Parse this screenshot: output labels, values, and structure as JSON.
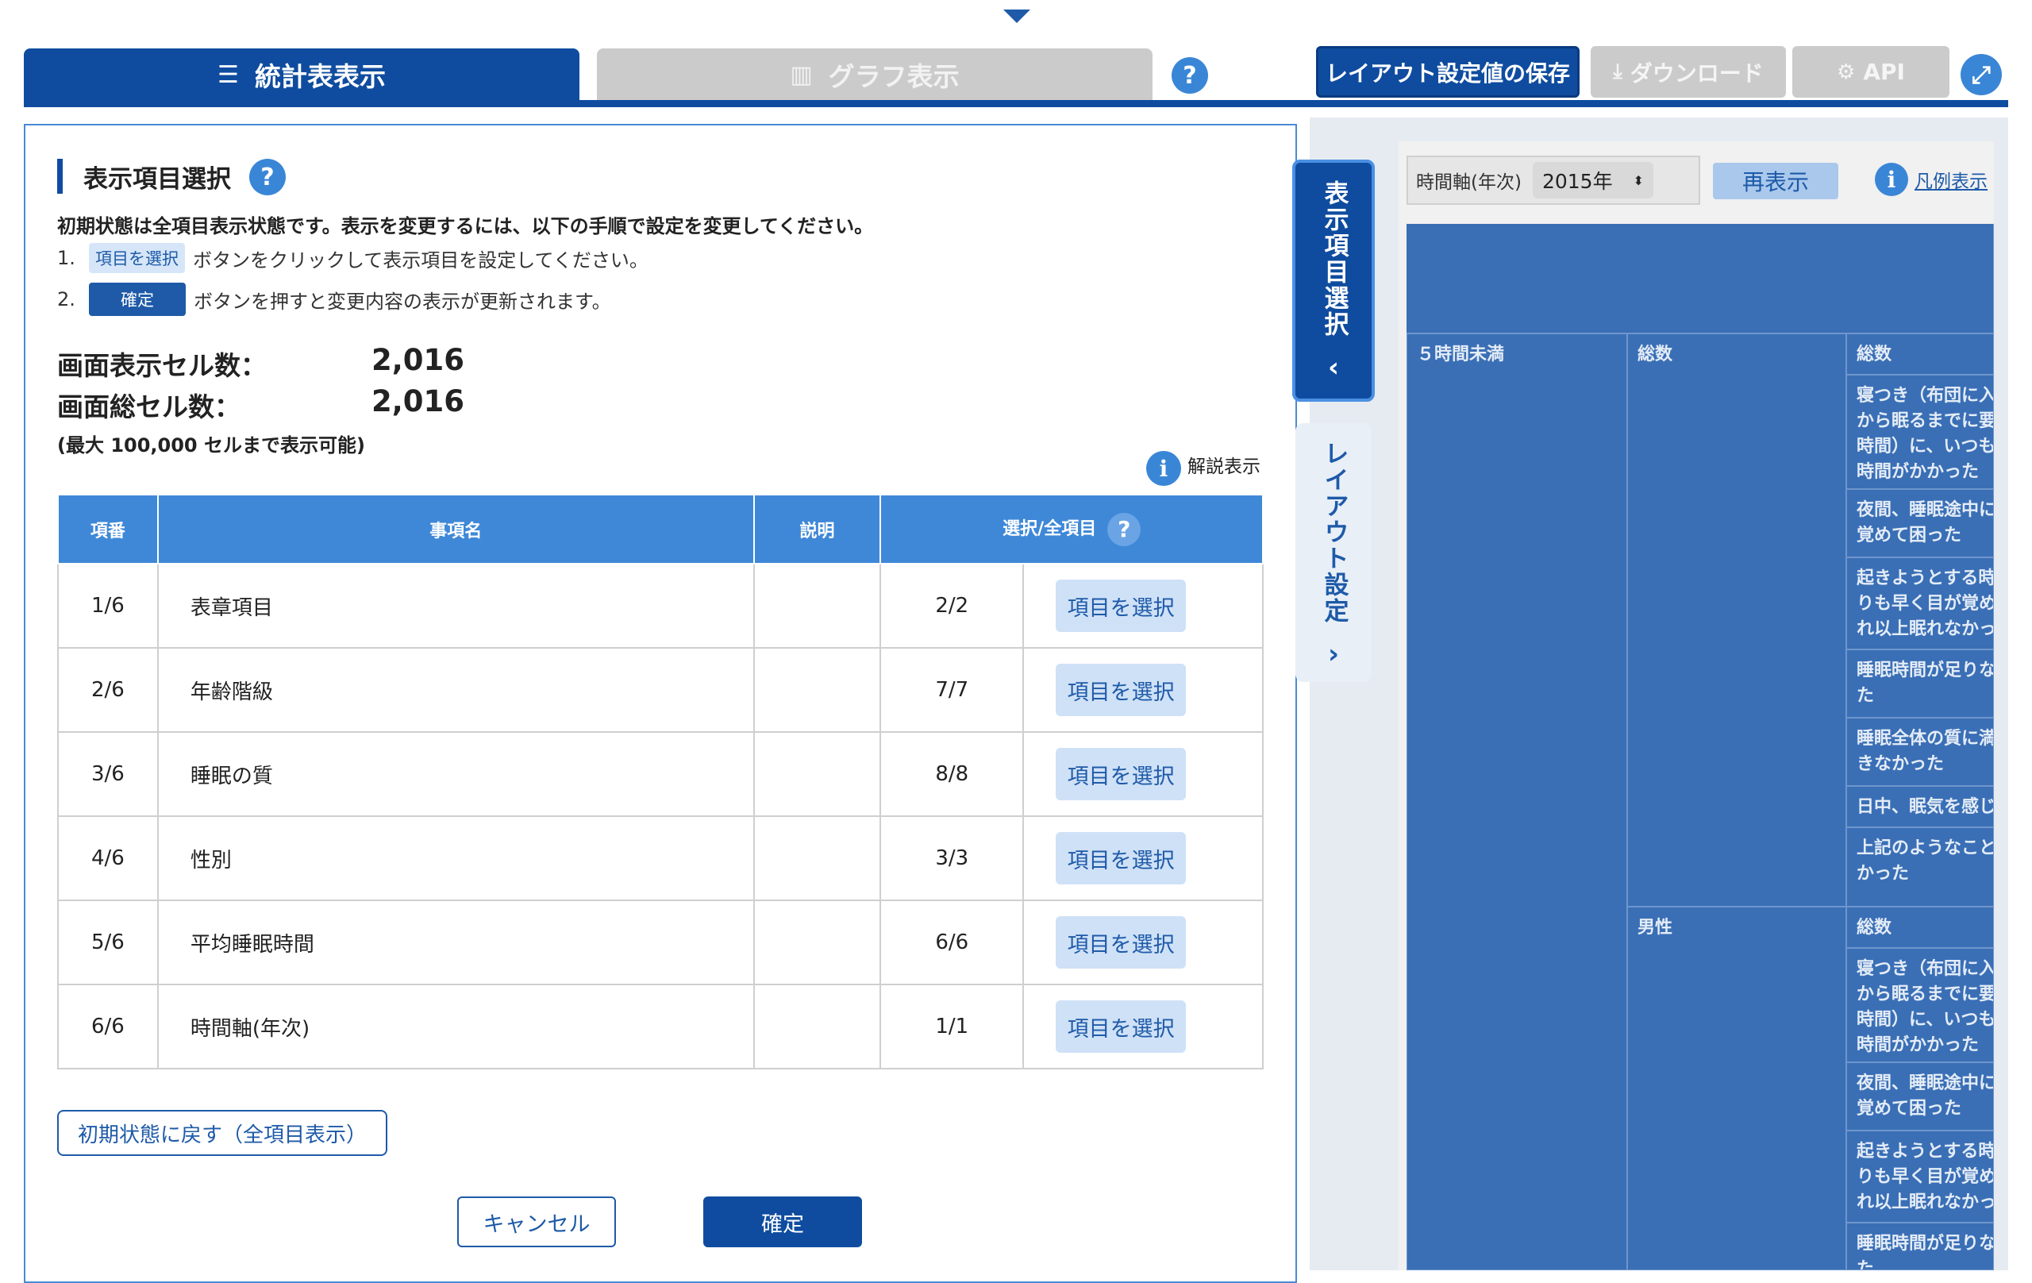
{
  "tabs": {
    "table_label": "統計表表示",
    "graph_label": "グラフ表示"
  },
  "toolbar": {
    "save_label": "レイアウト設定値の保存",
    "download_label": "ダウンロード",
    "api_label": "API"
  },
  "section": {
    "title": "表示項目選択",
    "help_mark": "?",
    "instruction": "初期状態は全項目表示状態です。表示を変更するには、以下の手順で設定を変更してください。",
    "step1_num": "1.",
    "step1_chip": "項目を選択",
    "step1_text": "ボタンをクリックして表示項目を設定してください。",
    "step2_num": "2.",
    "step2_chip": "確定",
    "step2_text": "ボタンを押すと変更内容の表示が更新されます。"
  },
  "cells": {
    "display_label": "画面表示セル数：",
    "display_value": "2,016",
    "total_label": "画面総セル数：",
    "total_value": "2,016",
    "note": "(最大 100,000 セルまで表示可能)"
  },
  "explain_label": "解説表示",
  "table": {
    "headers": [
      "項番",
      "事項名",
      "説明",
      "選択/全項目"
    ],
    "button_label": "項目を選択",
    "rows": [
      {
        "no": "1/6",
        "name": "表章項目",
        "selected": "2/2"
      },
      {
        "no": "2/6",
        "name": "年齢階級",
        "selected": "7/7"
      },
      {
        "no": "3/6",
        "name": "睡眠の質",
        "selected": "8/8"
      },
      {
        "no": "4/6",
        "name": "性別",
        "selected": "3/3"
      },
      {
        "no": "5/6",
        "name": "平均睡眠時間",
        "selected": "6/6"
      },
      {
        "no": "6/6",
        "name": "時間軸(年次)",
        "selected": "1/1"
      }
    ]
  },
  "reset_label": "初期状態に戻す（全項目表示）",
  "cancel_label": "キャンセル",
  "ok_label": "確定",
  "side_tabs": {
    "select_label": "表示項目選択",
    "layout_label": "レイアウト設定"
  },
  "right": {
    "time_axis_label": "時間軸(年次)",
    "year_value": "2015年",
    "redisplay_label": "再表示",
    "legend_label": "凡例表示",
    "grid": {
      "col1": "５時間未満",
      "group1": "総数",
      "group2": "男性",
      "items": [
        "総数",
        "寝つき（布団に入\nから眠るまでに要\n時間）に、いつも\n時間がかかった",
        "夜間、睡眠途中に\n覚めて困った",
        "起きようとする時\nりも早く目が覚め\nれ以上眠れなかっ",
        "睡眠時間が足りな\nた",
        "睡眠全体の質に満\nきなかった",
        "日中、眠気を感じ",
        "上記のようなこと\nかった"
      ]
    }
  },
  "colors": {
    "primary": "#0f4c9f",
    "accent": "#3a86d6",
    "grid_bg": "#3a6fb6"
  }
}
